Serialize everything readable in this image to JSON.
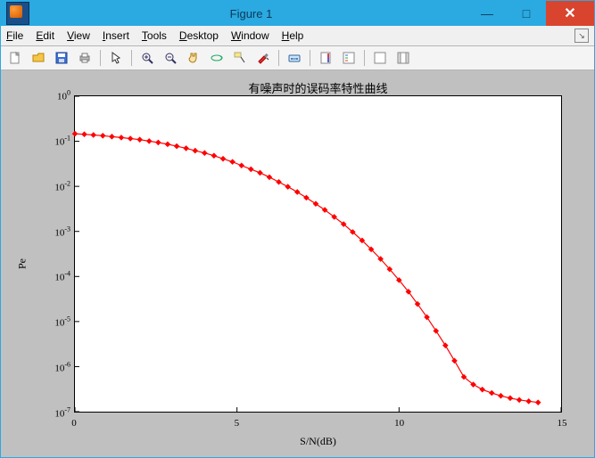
{
  "window": {
    "title": "Figure 1",
    "minimize": "—",
    "maximize": "□",
    "close": "✕"
  },
  "menubar": {
    "file": "File",
    "edit": "Edit",
    "view": "View",
    "insert": "Insert",
    "tools": "Tools",
    "desktop": "Desktop",
    "window": "Window",
    "help": "Help"
  },
  "toolbar": {
    "new": "new",
    "open": "open",
    "save": "save",
    "print": "print",
    "pointer": "pointer",
    "zoomin": "zoom-in",
    "zoomout": "zoom-out",
    "pan": "pan",
    "rotate": "rotate3d",
    "datacursor": "data-cursor",
    "brush": "brush",
    "link": "link",
    "colorbar": "colorbar",
    "legend": "legend",
    "hideplot": "hide-plot-tools",
    "showplot": "show-plot-tools"
  },
  "chart_data": {
    "type": "line",
    "title": "有噪声时的误码率特性曲线",
    "xlabel": "S/N(dB)",
    "ylabel": "Pe",
    "xlim": [
      0,
      15
    ],
    "ylim_log10": [
      -7,
      0
    ],
    "xticks": [
      0,
      5,
      10,
      15
    ],
    "ytick_exponents": [
      0,
      -1,
      -2,
      -3,
      -4,
      -5,
      -6,
      -7
    ],
    "marker": "diamond",
    "color": "#ff0000",
    "x": [
      0.0,
      0.29,
      0.57,
      0.86,
      1.14,
      1.43,
      1.71,
      2.0,
      2.29,
      2.57,
      2.86,
      3.14,
      3.43,
      3.71,
      4.0,
      4.29,
      4.57,
      4.86,
      5.14,
      5.43,
      5.71,
      6.0,
      6.29,
      6.57,
      6.86,
      7.14,
      7.43,
      7.71,
      8.0,
      8.29,
      8.57,
      8.86,
      9.14,
      9.43,
      9.71,
      10.0,
      10.29,
      10.57,
      10.86,
      11.14,
      11.43,
      11.71,
      12.0,
      12.29,
      12.57,
      12.86,
      13.14,
      13.43,
      13.71,
      14.0,
      14.29
    ],
    "y": [
      0.147,
      0.143,
      0.138,
      0.133,
      0.127,
      0.121,
      0.115,
      0.109,
      0.101,
      0.094,
      0.086,
      0.078,
      0.07,
      0.062,
      0.055,
      0.048,
      0.041,
      0.035,
      0.029,
      0.024,
      0.02,
      0.016,
      0.0125,
      0.0098,
      0.0075,
      0.0056,
      0.0041,
      0.003,
      0.0021,
      0.00145,
      0.00097,
      0.00063,
      0.0004,
      0.000245,
      0.000145,
      8.3e-05,
      4.6e-05,
      2.45e-05,
      1.25e-05,
      6.2e-06,
      2.95e-06,
      1.35e-06,
      5.9e-07,
      4e-07,
      3.1e-07,
      2.6e-07,
      2.25e-07,
      2e-07,
      1.82e-07,
      1.7e-07,
      1.6e-07
    ]
  }
}
